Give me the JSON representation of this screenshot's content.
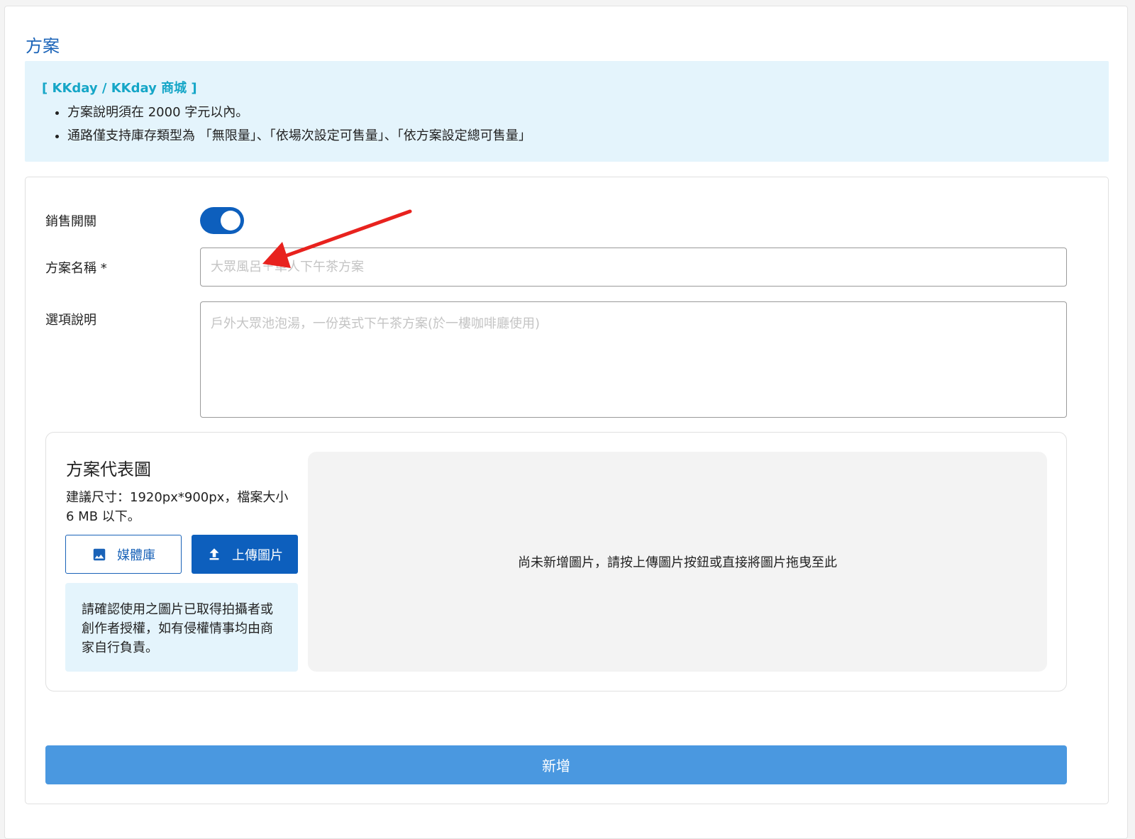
{
  "section": {
    "title": "方案"
  },
  "notice": {
    "title": "[ KKday / KKday 商城 ]",
    "items": [
      "方案說明須在 2000 字元以內。",
      "通路僅支持庫存類型為 「無限量」、「依場次設定可售量」、「依方案設定總可售量」"
    ]
  },
  "form": {
    "sales_switch_label": "銷售開關",
    "sales_switch_on": true,
    "plan_name_label": "方案名稱 *",
    "plan_name_placeholder": "大眾風呂＋單人下午茶方案",
    "plan_name_value": "",
    "option_desc_label": "選項說明",
    "option_desc_placeholder": "戶外大眾池泡湯，一份英式下午茶方案(於一樓咖啡廳使用)",
    "option_desc_value": ""
  },
  "image_section": {
    "title": "方案代表圖",
    "hint": "建議尺寸：1920px*900px，檔案大小 6 MB 以下。",
    "media_button_label": "媒體庫",
    "upload_button_label": "上傳圖片",
    "copyright_note": "請確認使用之圖片已取得拍攝者或創作者授權，如有侵權情事均由商家自行負責。",
    "dropzone_text": "尚未新增圖片，請按上傳圖片按鈕或直接將圖片拖曳至此"
  },
  "submit": {
    "label": "新增"
  },
  "colors": {
    "primary": "#0d5fbd",
    "title_blue": "#1a63b8",
    "notice_bg": "#e4f4fc",
    "notice_title": "#15a6c7",
    "submit_bg": "#4a98e0",
    "annotation_arrow": "#e8221e"
  },
  "icons": {
    "media": "image-icon",
    "upload": "upload-icon"
  }
}
